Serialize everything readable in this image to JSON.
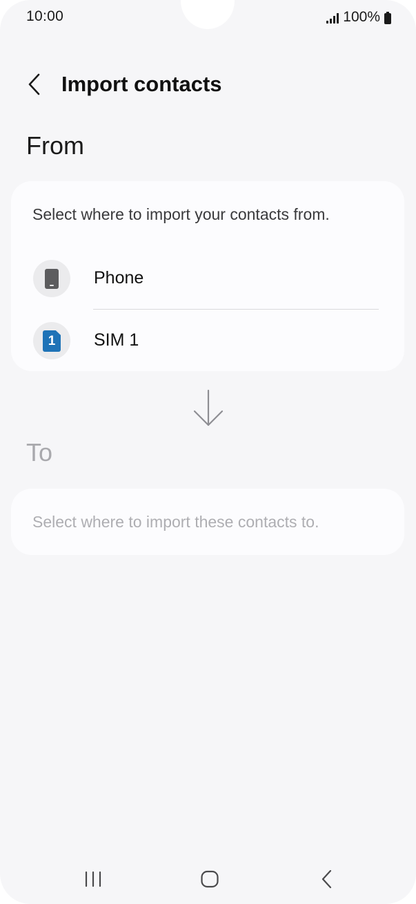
{
  "status_bar": {
    "time": "10:00",
    "battery": "100%",
    "icons": [
      "signal-icon",
      "battery-icon"
    ]
  },
  "header": {
    "back_icon": "chevron-left-icon",
    "title": "Import contacts"
  },
  "from_section": {
    "label": "From",
    "hint": "Select where to import your contacts from.",
    "items": [
      {
        "label": "Phone",
        "icon": "phone-icon"
      },
      {
        "label": "SIM 1",
        "icon": "sim-card-icon",
        "icon_text": "1",
        "icon_color": "#1f73b7"
      }
    ]
  },
  "arrow_icon": "arrow-down-icon",
  "to_section": {
    "label": "To",
    "hint": "Select where to import these contacts to."
  },
  "nav_bar": {
    "icons": [
      "recents-icon",
      "home-icon",
      "back-icon"
    ]
  },
  "colors": {
    "background": "#f6f6f8",
    "card": "#fcfcfe",
    "sim_accent": "#1f73b7",
    "disabled_text": "#aeaeb2"
  }
}
